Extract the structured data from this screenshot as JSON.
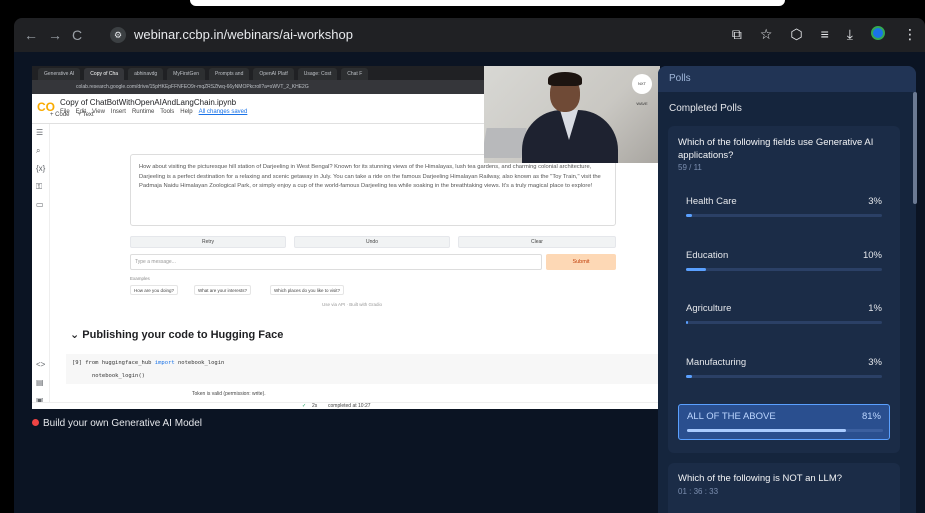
{
  "browser": {
    "url": "webinar.ccbp.in/webinars/ai-workshop",
    "nav": {
      "back": "←",
      "forward": "→",
      "reload": "C"
    },
    "site_icon": "⚙"
  },
  "colab": {
    "tabs": [
      "Generative AI",
      "Copy of Cha",
      "abhinavdg",
      "MyFirstGen",
      "Prompts and",
      "OpenAI Platf",
      "Usage: Cost",
      "Chat F"
    ],
    "url": "colab.research.google.com/drive/15pHKEpFFNFEO9r-mqZRSZfwq-66yNMOPkcroll?a=sWVT_2_KHE2G",
    "logo": "CO",
    "notebook_title": "Copy of ChatBotWithOpenAIAndLangChain.ipynb",
    "menu": [
      "File",
      "Edit",
      "View",
      "Insert",
      "Runtime",
      "Tools",
      "Help"
    ],
    "saved_label": "All changes saved",
    "code_btn": "+ Code",
    "text_btn": "+ Text",
    "output_text": "How about visiting the picturesque hill station of Darjeeling in West Bengal? Known for its stunning views of the Himalayas, lush tea gardens, and charming colonial architecture, Darjeeling is a perfect destination for a relaxing and scenic getaway in July. You can take a ride on the famous Darjeeling Himalayan Railway, also known as the \"Toy Train,\" visit the Padmaja Naidu Himalayan Zoological Park, or simply enjoy a cup of the world-famous Darjeeling tea while soaking in the breathtaking views. It's a truly magical place to explore!",
    "retry": "Retry",
    "undo": "Undo",
    "clear": "Clear",
    "input_placeholder": "Type a message...",
    "submit": "Submit",
    "examples_label": "Examples",
    "examples": [
      "How are you doing?",
      "What are your interests?",
      "Which places do you like to visit?"
    ],
    "api_footer": "Use via API  ·  Built with Gradio",
    "section_heading": "Publishing your code to Hugging Face",
    "code_line1_prefix": "[9]  from",
    "code_line1_module": "huggingface_hub",
    "code_line1_import": "import",
    "code_line1_name": "notebook_login",
    "code_line2": "notebook_login()",
    "token_valid": "Token is valid (permission: write).",
    "status_check": "✓",
    "status_time": "2s",
    "status_done": "completed at 10:27",
    "presenter_badge": "NXT WAVE"
  },
  "session_title": "Build your own Generative AI Model",
  "polls": {
    "header": "Polls",
    "completed_title": "Completed Polls",
    "poll1": {
      "question": "Which of the following fields use Generative AI applications?",
      "count": "59 / 11",
      "options": [
        {
          "label": "Health Care",
          "pct": "3%",
          "value": 3
        },
        {
          "label": "Education",
          "pct": "10%",
          "value": 10
        },
        {
          "label": "Agriculture",
          "pct": "1%",
          "value": 1
        },
        {
          "label": "Manufacturing",
          "pct": "3%",
          "value": 3
        },
        {
          "label": "ALL OF THE ABOVE",
          "pct": "81%",
          "value": 81
        }
      ]
    },
    "poll2": {
      "question": "Which of the following is NOT an LLM?",
      "time": "01 : 36 : 33"
    }
  },
  "colors": {
    "accent": "#5aa0ff",
    "panel": "#15253d",
    "card": "#1b2c47",
    "correct": "#2a4f8f",
    "live": "#ef4444"
  }
}
